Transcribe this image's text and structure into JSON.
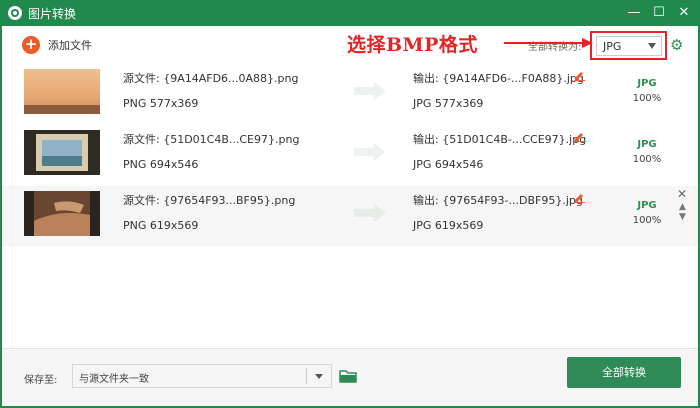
{
  "window": {
    "title": "图片转换"
  },
  "toolbar": {
    "add_label": "添加文件",
    "annotation": "选择BMP格式",
    "format_label": "全部转换为:",
    "format_value": "JPG"
  },
  "files": [
    {
      "source": "源文件: {9A14AFD6...0A88}.png",
      "source_meta": "PNG  577x369",
      "output": "输出: {9A14AFD6-...F0A88}.jpg",
      "output_meta": "JPG  577x369",
      "format": "JPG",
      "progress": "100%",
      "thumb_colors": [
        "#e7a874",
        "#c98a5e"
      ]
    },
    {
      "source": "源文件: {51D01C4B...CE97}.png",
      "source_meta": "PNG  694x546",
      "output": "输出: {51D01C4B-...CCE97}.jpg",
      "output_meta": "JPG  694x546",
      "format": "JPG",
      "progress": "100%",
      "thumb_colors": [
        "#6f8fa0",
        "#2f2a22"
      ]
    },
    {
      "source": "源文件: {97654F93...BF95}.png",
      "source_meta": "PNG  619x569",
      "output": "输出: {97654F93-...DBF95}.jpg",
      "output_meta": "JPG  619x569",
      "format": "JPG",
      "progress": "100%",
      "thumb_colors": [
        "#9b5a36",
        "#2a2420"
      ]
    }
  ],
  "footer": {
    "save_label": "保存至:",
    "save_path": "与源文件夹一致",
    "convert_label": "全部转换"
  },
  "colors": {
    "brand": "#1f8a4c",
    "accent": "#2e8b57",
    "annotation": "#e52525"
  }
}
